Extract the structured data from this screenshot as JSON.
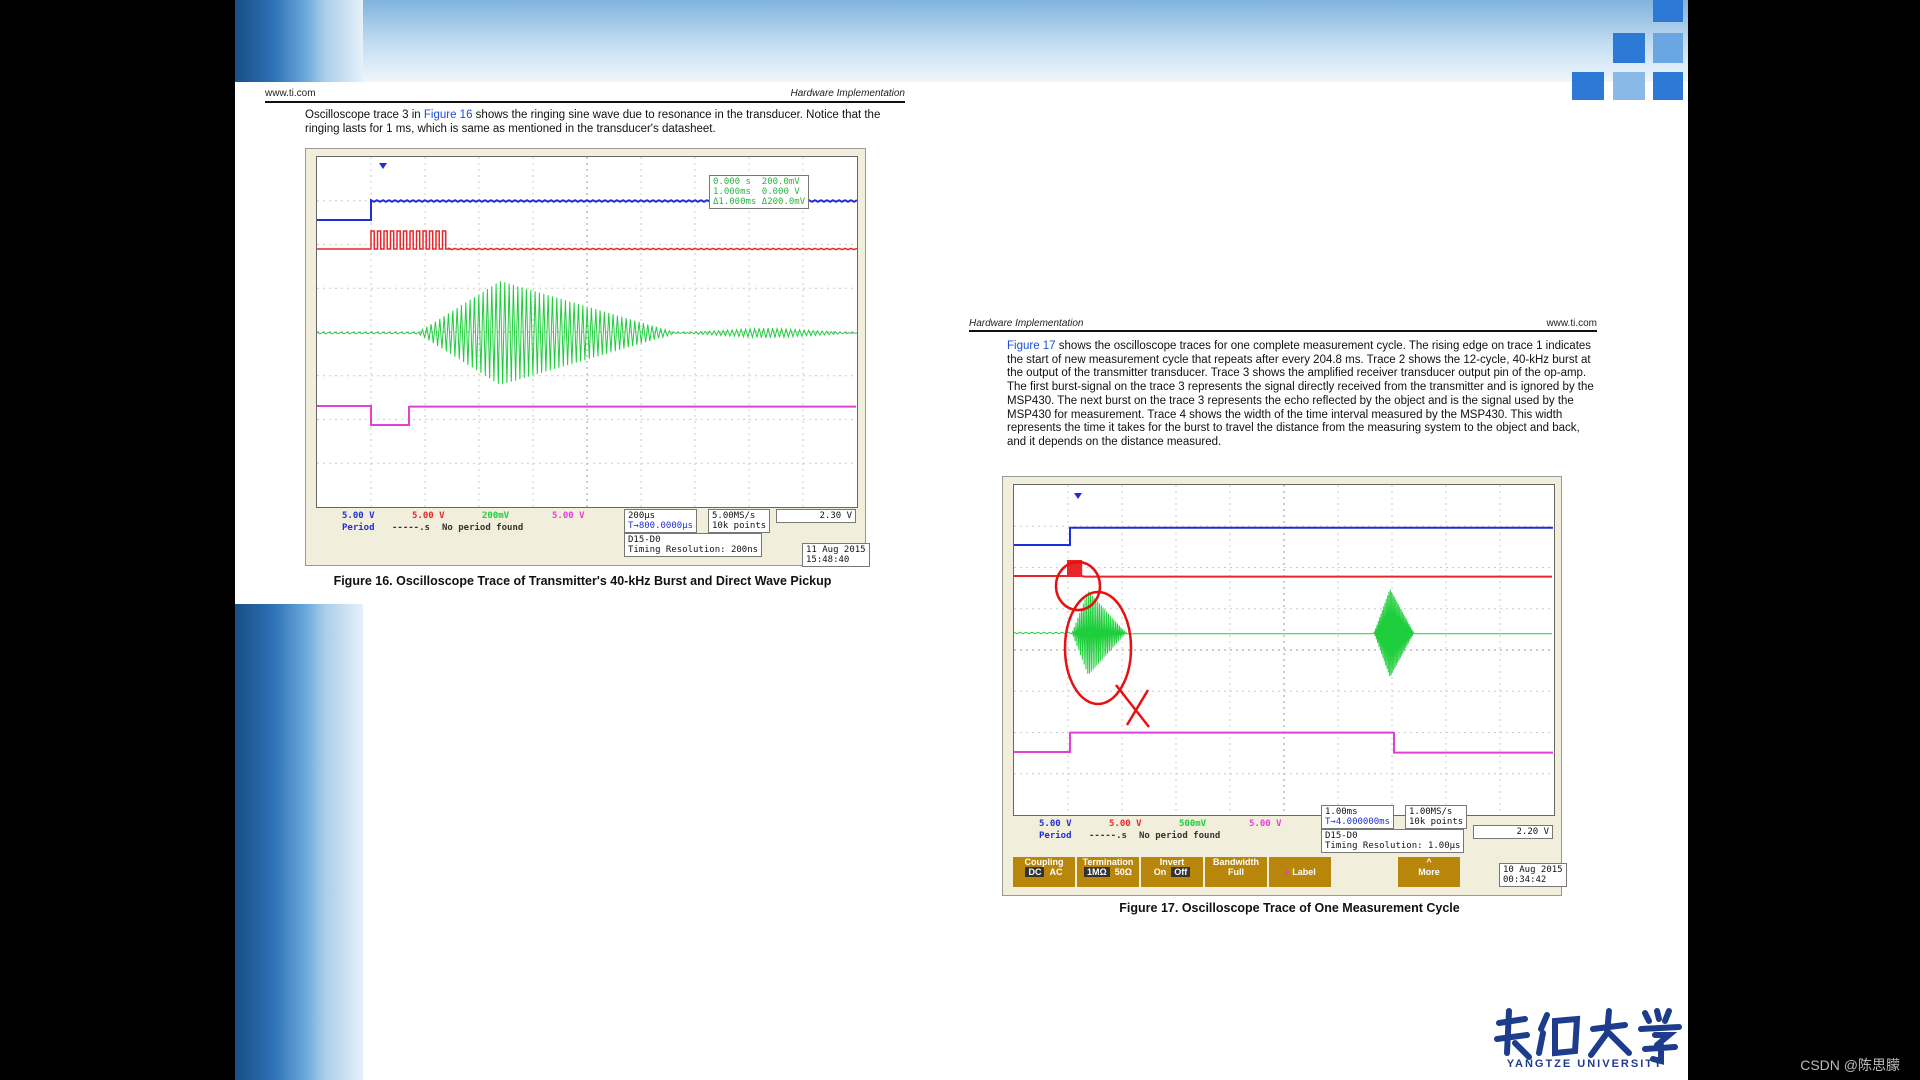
{
  "colors": {
    "ch1": "#1f2fd6",
    "ch2": "#e8262a",
    "ch3": "#1fce3c",
    "ch4": "#e33fd6",
    "annotation": "#e81010",
    "link": "#1a4fd6"
  },
  "doc1": {
    "header_left": "www.ti.com",
    "header_right": "Hardware Implementation",
    "text_pre": "Oscilloscope trace 3 in ",
    "text_link": "Figure 16",
    "text_post": " shows the ringing sine wave due to resonance in the transducer. Notice that the ringing lasts for 1 ms, which is same as mentioned in the transducer's datasheet.",
    "caption": "Figure 16. Oscilloscope Trace of Transmitter's 40-kHz Burst and Direct Wave Pickup",
    "scope": {
      "cursor_box": [
        "0.000 s",
        "200.0mV",
        "1.000ms",
        "0.000 V",
        "Δ1.000ms",
        "Δ200.0mV"
      ],
      "channels": [
        "5.00 V",
        "5.00 V",
        "200mV",
        "5.00 V"
      ],
      "period_label": "Period",
      "period_value": "-----.s",
      "no_period": "No period found",
      "timebase": "200µs",
      "trigger_pos": "T→800.0000µs",
      "sample_rate": "5.00MS/s",
      "record_length": "10k points",
      "trigger_level": "2.30 V",
      "digital_label": "D15-D0",
      "timing_res": "Timing Resolution: 200ns",
      "date": "11 Aug 2015",
      "time": "15:48:40"
    }
  },
  "doc2": {
    "header_left": "Hardware Implementation",
    "header_right": "www.ti.com",
    "text_link": "Figure 17",
    "text_post": " shows the oscilloscope traces for one complete measurement cycle. The rising edge on trace 1 indicates the start of new measurement cycle that repeats after every 204.8 ms. Trace 2 shows the 12-cycle, 40-kHz burst at the output of the transmitter transducer. Trace 3 shows the amplified receiver transducer output pin of the op-amp. The first burst-signal on the trace 3 represents the signal directly received from the transmitter and is ignored by the MSP430. The next burst on the trace 3 represents the echo reflected by the object and is the signal used by the MSP430 for measurement. Trace 4 shows the width of the time interval measured by the MSP430. This width represents the time it takes for the burst to travel the distance from the measuring system to the object and back, and it depends on the distance measured.",
    "caption": "Figure 17. Oscilloscope Trace of One Measurement Cycle",
    "scope": {
      "channels": [
        "5.00 V",
        "5.00 V",
        "500mV",
        "5.00 V"
      ],
      "period_label": "Period",
      "period_value": "-----.s",
      "no_period": "No period found",
      "timebase": "1.00ms",
      "trigger_pos": "T→4.000000ms",
      "sample_rate": "1.00MS/s",
      "record_length": "10k points",
      "trigger_level": "2.20 V",
      "digital_label": "D15-D0",
      "timing_res": "Timing Resolution: 1.00µs",
      "date": "10 Aug 2015",
      "time": "00:34:42",
      "menu": [
        {
          "title": "Coupling",
          "opts": [
            "DC",
            "AC"
          ]
        },
        {
          "title": "Termination",
          "opts": [
            "1MΩ",
            "50Ω"
          ]
        },
        {
          "title": "Invert",
          "opts": [
            "On",
            "Off"
          ]
        },
        {
          "title": "Bandwidth",
          "opts": [
            "Full"
          ]
        },
        {
          "title": "Label",
          "opts": []
        },
        {
          "title": "More",
          "opts": []
        }
      ]
    }
  },
  "logo": {
    "university_en": "YANGTZE UNIVERSITY"
  },
  "watermark": "CSDN @陈思朦"
}
